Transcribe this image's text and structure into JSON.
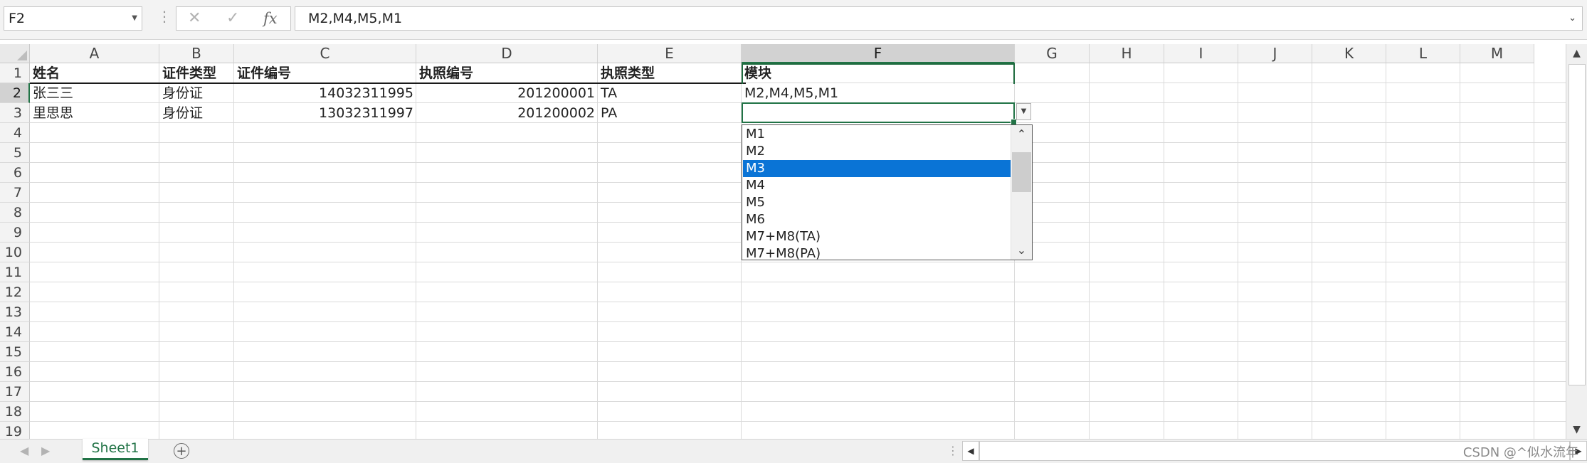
{
  "formula_bar": {
    "name_box": "F2",
    "formula": "M2,M4,M5,M1",
    "cancel_icon": "✕",
    "enter_icon": "✓",
    "fx_label": "fx"
  },
  "columns": [
    "A",
    "B",
    "C",
    "D",
    "E",
    "F",
    "G",
    "H",
    "I",
    "J",
    "K",
    "L",
    "M"
  ],
  "rows": [
    "1",
    "2",
    "3",
    "4",
    "5",
    "6",
    "7",
    "8",
    "9",
    "10",
    "11",
    "12",
    "13",
    "14",
    "15",
    "16",
    "17",
    "18",
    "19"
  ],
  "table": {
    "headers": [
      "姓名",
      "证件类型",
      "证件编号",
      "执照编号",
      "执照类型",
      "模块"
    ],
    "data": [
      [
        "张三三",
        "身份证",
        "14032311995",
        "201200001",
        "TA",
        "M2,M4,M5,M1"
      ],
      [
        "里思思",
        "身份证",
        "13032311997",
        "201200002",
        "PA",
        ""
      ]
    ]
  },
  "dropdown": {
    "items": [
      "M1",
      "M2",
      "M3",
      "M4",
      "M5",
      "M6",
      "M7+M8(TA)",
      "M7+M8(PA)"
    ],
    "selected": "M3"
  },
  "sheet_tabs": [
    "Sheet1"
  ],
  "watermark": "CSDN @^似水流年",
  "colors": {
    "accent": "#217346",
    "selection": "#0a74d6"
  }
}
